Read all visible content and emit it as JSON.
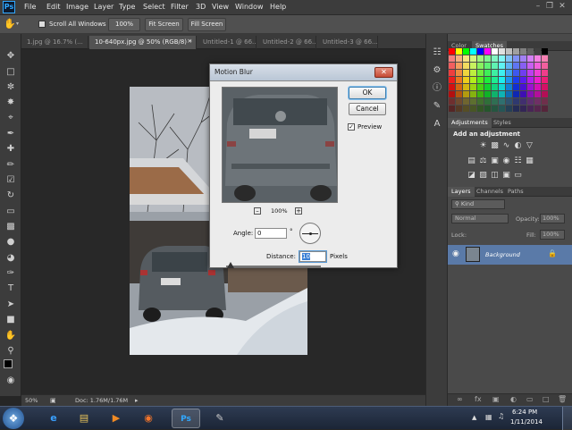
{
  "menubar": {
    "logo": "Ps",
    "items": [
      "File",
      "Edit",
      "Image",
      "Layer",
      "Type",
      "Select",
      "Filter",
      "3D",
      "View",
      "Window",
      "Help"
    ]
  },
  "options": {
    "scroll_all_windows": "Scroll All Windows",
    "zoom_100": "100%",
    "fit_screen": "Fit Screen",
    "fill_screen": "Fill Screen"
  },
  "tabs": [
    {
      "label": "1.jpg @ 16.7% (..."
    },
    {
      "label": "10-640px.jpg @ 50% (RGB/8) *"
    },
    {
      "label": "Untitled-1 @ 66..."
    },
    {
      "label": "Untitled-2 @ 66..."
    },
    {
      "label": "Untitled-3 @ 66..."
    }
  ],
  "status": {
    "zoom": "50%",
    "doc": "Doc: 1.76M/1.76M"
  },
  "panels": {
    "color_tab": "Color",
    "swatches_tab": "Swatches",
    "adjustments_tab": "Adjustments",
    "styles_tab": "Styles",
    "add_adjustment": "Add an adjustment",
    "layers_tab": "Layers",
    "channels_tab": "Channels",
    "paths_tab": "Paths",
    "kind": "Kind",
    "blend_mode": "Normal",
    "opacity_label": "Opacity:",
    "opacity_value": "100%",
    "lock_label": "Lock:",
    "fill_label": "Fill:",
    "fill_value": "100%",
    "layer_name": "Background"
  },
  "dialog": {
    "title": "Motion Blur",
    "ok": "OK",
    "cancel": "Cancel",
    "preview_label": "Preview",
    "preview_checked": true,
    "zoom": "100%",
    "angle_label": "Angle:",
    "angle_value": "0",
    "angle_unit": "°",
    "distance_label": "Distance:",
    "distance_value": "10",
    "distance_unit": "Pixels"
  },
  "taskbar": {
    "time": "6:24 PM",
    "date": "1/11/2014"
  },
  "colors": {
    "ps_blue": "#31a8ff",
    "panel_bg": "#4a4a4a",
    "dialog_bg": "#ececec"
  }
}
